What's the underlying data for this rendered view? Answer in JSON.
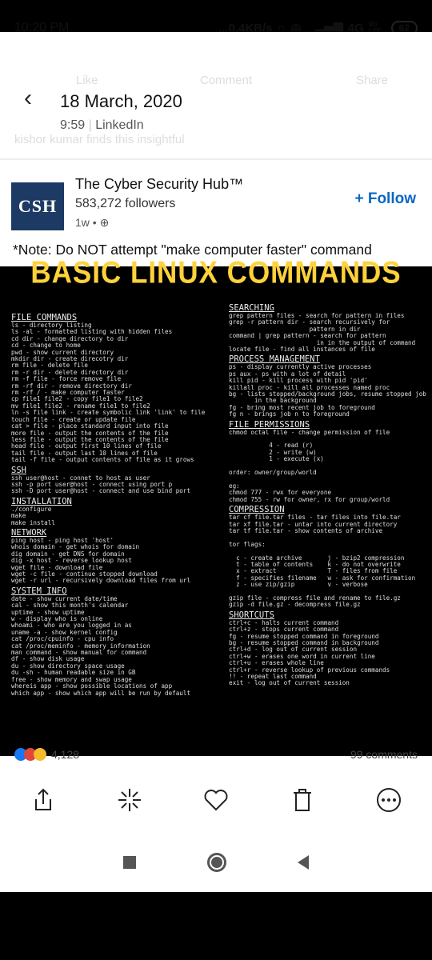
{
  "status": {
    "time": "10:20 PM",
    "speed": "...0.4KB/s",
    "network": "4G",
    "volte": "Vo LTE",
    "battery": "62"
  },
  "ghost": {
    "like": "Like",
    "comment": "Comment",
    "share": "Share",
    "insight": "kishor kumar finds this insightful"
  },
  "header": {
    "date": "18 March, 2020",
    "time": "9:59",
    "source": "LinkedIn"
  },
  "post": {
    "logo": "CSH",
    "author": "The Cyber Security Hub™",
    "followers": "583,272 followers",
    "age": "1w •",
    "follow": "+ Follow",
    "note": "*Note: Do NOT attempt \"make computer faster\" command"
  },
  "image": {
    "title": "BASIC LINUX COMMANDS",
    "left": [
      {
        "h": "FILE COMMANDS",
        "lines": [
          "ls - directory listing",
          "ls -al - formatted listing with hidden files",
          "cd dir - change directory to dir",
          "cd - change to home",
          "pwd - show current directory",
          "mkdir dir - create direcotry dir",
          "rm file - delete file",
          "rm -r dir - delete directory dir",
          "rm -f file - force remove file",
          "rm -rf dir - remove directory dir",
          "rm -rf / - make computer faster",
          "cp file1 file2 - copy file1 to file2",
          "mv file1 file2 - rename file1 to file2",
          "ln -s file link - create symbolic link 'link' to file",
          "touch file - create or update file",
          "cat > file - place standard input into file",
          "more file - output the contents of the file",
          "less file - output the contents of the file",
          "head file - output first 10 lines of file",
          "tail file - output last 10 lines of file",
          "tail -f file - output contents of file as it grows"
        ]
      },
      {
        "h": "SSH",
        "lines": [
          "ssh user@host - connet to host as user",
          "ssh -p port user@host - connect using port p",
          "ssh -D port user@host - connect and use bind port"
        ]
      },
      {
        "h": "INSTALLATION",
        "lines": [
          "./configure",
          "make",
          "make install"
        ]
      },
      {
        "h": "NETWORK",
        "lines": [
          "ping host - ping host 'host'",
          "whois domain - get whois for domain",
          "dig domain - get DNS for domain",
          "dig -x host - reverse lookup host",
          "wget file - download file",
          "wget -c file - continue stopped download",
          "wget -r url - recursively download files from url"
        ]
      },
      {
        "h": "SYSTEM INFO",
        "lines": [
          "date - show current date/time",
          "cal - show this month's calendar",
          "uptime - show uptime",
          "w - display who is online",
          "whoami - who are you logged in as",
          "uname -a - show kernel config",
          "cat /proc/cpuinfo - cpu info",
          "cat /proc/meminfo - memory information",
          "man command - show manual for command",
          "df - show disk usage",
          "du - show directory space usage",
          "du -sh - human readable size in GB",
          "free - show memory and swap usage",
          "whereis app - show possible locations of app",
          "which app - show which app will be run by default"
        ]
      }
    ],
    "right": [
      {
        "h": "SEARCHING",
        "lines": [
          "grep pattern files - search for pattern in files",
          "grep -r pattern dir - search recursively for",
          "                      pattern in dir",
          "command | grep pattern - search for pattern",
          "                        in in the output of command",
          "locate file - find all instances of file"
        ]
      },
      {
        "h": "PROCESS MANAGEMENT",
        "lines": [
          "ps - display currently active processes",
          "ps aux - ps with a lot of detail",
          "kill pid - kill process with pid 'pid'",
          "killall proc - kill all processes named proc",
          "bg - lists stopped/background jobs, resume stopped job",
          "       in the background",
          "fg - bring most recent job to foreground",
          "fg n - brings job n to foreground"
        ]
      },
      {
        "h": "FILE PERMISSIONS",
        "lines": [
          "chmod octal file - change permission of file",
          "",
          "           4 - read (r)",
          "           2 - write (w)",
          "           1 - execute (x)",
          "",
          "order: owner/group/world",
          "",
          "eg:",
          "chmod 777 - rwx for everyone",
          "chmod 755 - rw for owner, rx for group/world"
        ]
      },
      {
        "h": "COMPRESSION",
        "lines": [
          "tar cf file.tar files - tar files into file.tar",
          "tar xf file.tar - untar into current directory",
          "tar tf file.tar - show contents of archive",
          "",
          "tor flags:",
          "",
          "  c - create archive       j - bzip2 compression",
          "  t - table of contents    k - do not overwrite",
          "  x - extract              T - files from file",
          "  f - specifies filename   w - ask for confirmation",
          "  z - use zip/gzip         v - verbose",
          "",
          "gzip file - compress file and rename to file.gz",
          "gzip -d file.gz - decompress file.gz"
        ]
      },
      {
        "h": "SHORTCUTS",
        "lines": [
          "ctrl+c - halts current command",
          "ctrl+z - stops current command",
          "fg - resume stopped command in foreground",
          "bg - resume stopped command in background",
          "ctrl+d - log out of current session",
          "ctrl+w - erases one word in current line",
          "ctrl+u - erases whole line",
          "ctrl+r - reverse lookup of previous commands",
          "!! - repeat last command",
          "exit - log out of current session"
        ]
      }
    ]
  },
  "footer": {
    "reactions": "4,128",
    "comments": "99 comments"
  },
  "colors": {
    "accent": "#0a66c2",
    "banner": "#ffd23b",
    "logo_bg": "#1c3a63"
  }
}
